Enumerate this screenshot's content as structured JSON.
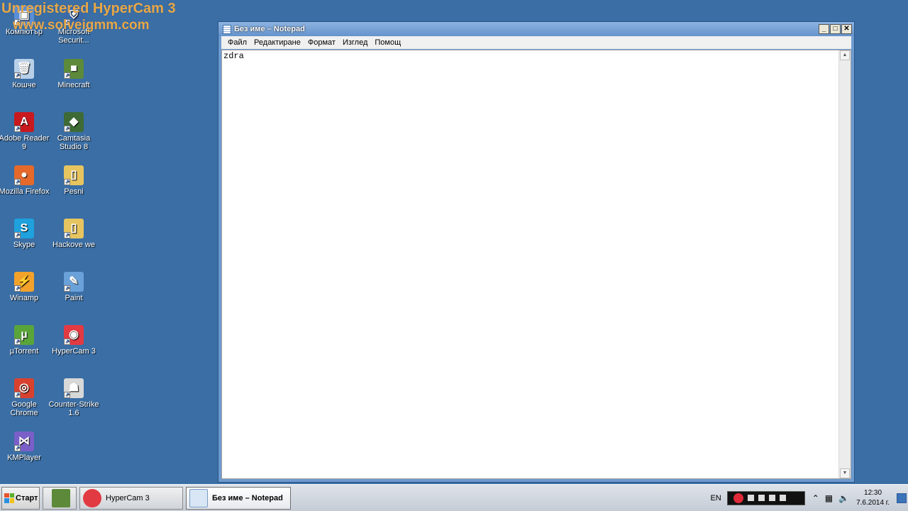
{
  "watermark": {
    "line1": "Unregistered HyperCam 3",
    "line2": "www.solveigmm.com"
  },
  "desktop": {
    "icons": [
      {
        "label": "Компютър",
        "color": "#5a8fd8",
        "glyph": "▣"
      },
      {
        "label": "Microsoft Securit...",
        "color": "#3c6aa8",
        "glyph": "⛨"
      },
      {
        "label": "Кошче",
        "color": "#b8cfe8",
        "glyph": "🗑"
      },
      {
        "label": "Minecraft",
        "color": "#5c8a3a",
        "glyph": "■"
      },
      {
        "label": "Adobe Reader 9",
        "color": "#c8191e",
        "glyph": "A"
      },
      {
        "label": "Camtasia Studio 8",
        "color": "#3e6b35",
        "glyph": "◆"
      },
      {
        "label": "Mozilla Firefox",
        "color": "#e5692b",
        "glyph": "●"
      },
      {
        "label": "Pesni",
        "color": "#e6c560",
        "glyph": "▯"
      },
      {
        "label": "Skype",
        "color": "#1ea1dd",
        "glyph": "S"
      },
      {
        "label": "Hackove we",
        "color": "#e6c560",
        "glyph": "▯"
      },
      {
        "label": "Winamp",
        "color": "#f2a22a",
        "glyph": "⚡"
      },
      {
        "label": "Paint",
        "color": "#6aa1d8",
        "glyph": "✎"
      },
      {
        "label": "µTorrent",
        "color": "#5aa53a",
        "glyph": "µ"
      },
      {
        "label": "HyperCam 3",
        "color": "#e23a42",
        "glyph": "◉"
      },
      {
        "label": "Google Chrome",
        "color": "#d9412f",
        "glyph": "◎"
      },
      {
        "label": "Counter-Strike 1.6",
        "color": "#d8d8d8",
        "glyph": "☗"
      },
      {
        "label": "KMPlayer",
        "color": "#7a5fc8",
        "glyph": "⋈"
      }
    ]
  },
  "notepad": {
    "title": "Без име – Notepad",
    "menu": [
      "Файл",
      "Редактиране",
      "Формат",
      "Изглед",
      "Помощ"
    ],
    "content": "zdra",
    "controls": {
      "minimize": "_",
      "maximize": "□",
      "close": "✕"
    }
  },
  "taskbar": {
    "start_label": "Старт",
    "buttons": [
      {
        "label": "HyperCam 3",
        "active": false
      },
      {
        "label": "Без име – Notepad",
        "active": true
      }
    ],
    "lang": "EN",
    "tray_expand": "⌃",
    "clock_time": "12:30",
    "clock_date": "7.6.2014 г."
  }
}
